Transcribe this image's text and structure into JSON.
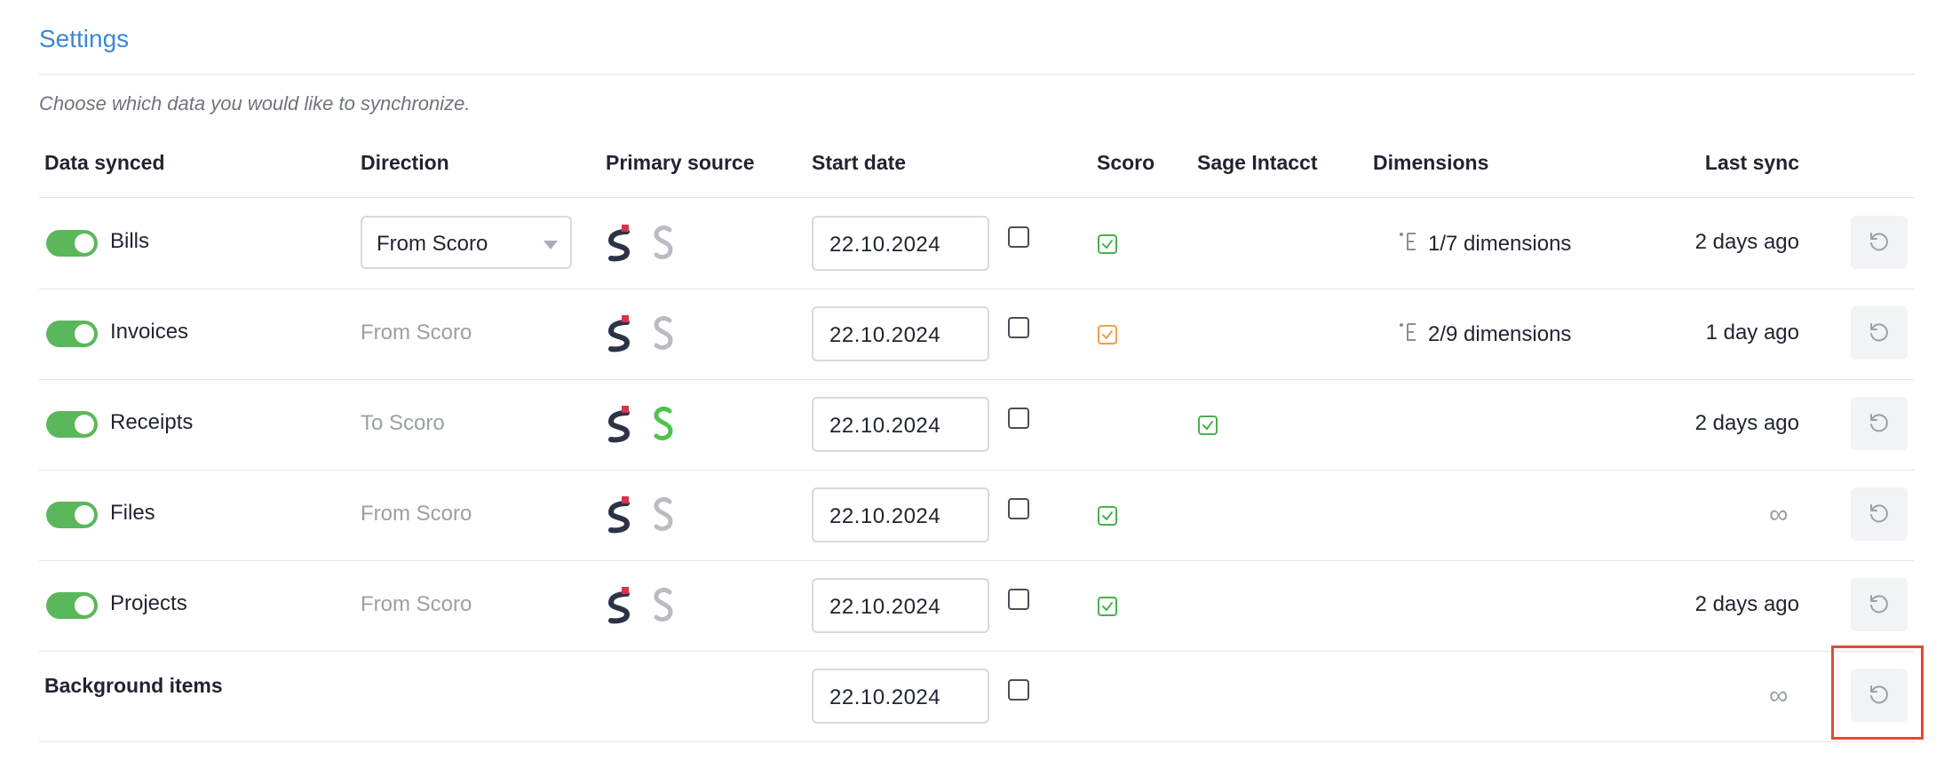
{
  "page": {
    "title": "Settings",
    "subtitle": "Choose which data you would like to synchronize."
  },
  "columns": {
    "data_synced": "Data synced",
    "direction": "Direction",
    "primary_source": "Primary source",
    "start_date": "Start date",
    "scoro": "Scoro",
    "sage_intacct": "Sage Intacct",
    "dimensions": "Dimensions",
    "last_sync": "Last sync"
  },
  "rows": [
    {
      "name": "Bills",
      "enabled": true,
      "direction": "From Scoro",
      "direction_is_select": true,
      "primary_source": "scoro",
      "start_date": "22.10.2024",
      "date_checked": false,
      "scoro_check": "green",
      "sage_check": null,
      "dimensions": "1/7 dimensions",
      "last_sync": "2 days ago"
    },
    {
      "name": "Invoices",
      "enabled": true,
      "direction": "From Scoro",
      "direction_is_select": false,
      "primary_source": "scoro",
      "start_date": "22.10.2024",
      "date_checked": false,
      "scoro_check": "orange",
      "sage_check": null,
      "dimensions": "2/9 dimensions",
      "last_sync": "1 day ago"
    },
    {
      "name": "Receipts",
      "enabled": true,
      "direction": "To Scoro",
      "direction_is_select": false,
      "primary_source": "sage",
      "start_date": "22.10.2024",
      "date_checked": false,
      "scoro_check": null,
      "sage_check": "green",
      "dimensions": "",
      "last_sync": "2 days ago"
    },
    {
      "name": "Files",
      "enabled": true,
      "direction": "From Scoro",
      "direction_is_select": false,
      "primary_source": "scoro",
      "start_date": "22.10.2024",
      "date_checked": false,
      "scoro_check": "green",
      "sage_check": null,
      "dimensions": "",
      "last_sync": "∞"
    },
    {
      "name": "Projects",
      "enabled": true,
      "direction": "From Scoro",
      "direction_is_select": false,
      "primary_source": "scoro",
      "start_date": "22.10.2024",
      "date_checked": false,
      "scoro_check": "green",
      "sage_check": null,
      "dimensions": "",
      "last_sync": "2 days ago"
    }
  ],
  "background": {
    "name": "Background items",
    "start_date": "22.10.2024",
    "last_sync": "∞"
  },
  "colors": {
    "accent": "#3b87d6",
    "toggle_on": "#5bb75b",
    "check_green": "#4caf50",
    "check_orange": "#f0a04b",
    "scoro_dark": "#2d3346",
    "scoro_red": "#d6354a",
    "sage_green": "#4cc44a",
    "muted": "#b9bcc2",
    "highlight": "#e04b36"
  }
}
